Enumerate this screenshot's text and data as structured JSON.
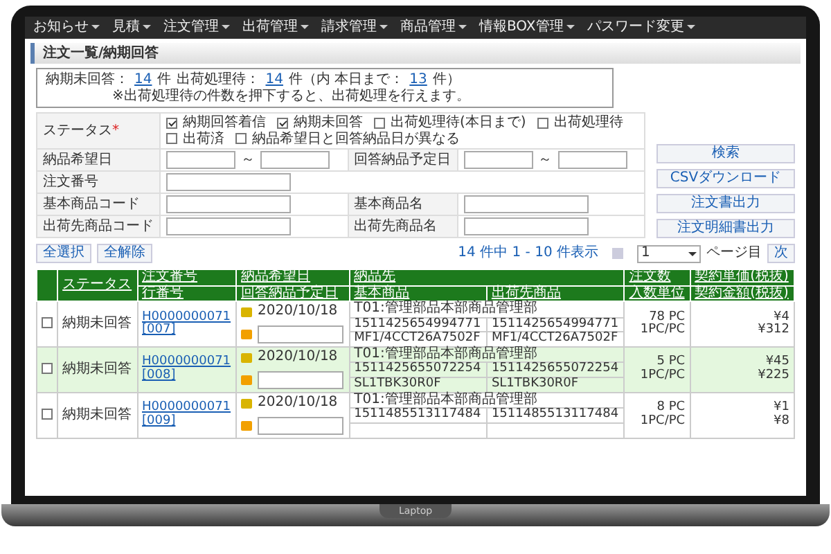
{
  "menu": [
    {
      "label": "お知らせ"
    },
    {
      "label": "見積"
    },
    {
      "label": "注文管理"
    },
    {
      "label": "出荷管理"
    },
    {
      "label": "請求管理"
    },
    {
      "label": "商品管理"
    },
    {
      "label": "情報BOX管理"
    },
    {
      "label": "パスワード変更"
    }
  ],
  "page_title": "注文一覧/納期回答",
  "summary": {
    "parts": [
      {
        "kind": "text",
        "text": "納期未回答："
      },
      {
        "kind": "link",
        "text": "14"
      },
      {
        "kind": "text",
        "text": "件"
      },
      {
        "kind": "text",
        "text": "出荷処理待："
      },
      {
        "kind": "link",
        "text": "14"
      },
      {
        "kind": "text",
        "text": "件（内 本日まで："
      },
      {
        "kind": "link",
        "text": "13"
      },
      {
        "kind": "text",
        "text": "件）"
      }
    ],
    "note": "※出荷処理待の件数を押下すると、出荷処理を行えます。"
  },
  "form": {
    "status_label": "ステータス",
    "required_mark": "*",
    "checkboxes": [
      {
        "label": "納期回答着信",
        "checked": true
      },
      {
        "label": "納期未回答",
        "checked": true
      },
      {
        "label": "出荷処理待(本日まで)",
        "checked": false
      },
      {
        "label": "出荷処理待",
        "checked": false
      },
      {
        "label": "出荷済",
        "checked": false
      },
      {
        "label": "納品希望日と回答納品日が異なる",
        "checked": false
      }
    ],
    "rows": [
      {
        "cells": [
          {
            "label": "納品希望日",
            "kind": "range",
            "separator": "～"
          },
          {
            "label": "回答納品予定日",
            "kind": "range",
            "separator": "～"
          }
        ]
      },
      {
        "cells": [
          {
            "label": "注文番号",
            "kind": "single"
          }
        ]
      },
      {
        "cells": [
          {
            "label": "基本商品コード",
            "kind": "single"
          },
          {
            "label": "基本商品名",
            "kind": "single"
          }
        ]
      },
      {
        "cells": [
          {
            "label": "出荷先商品コード",
            "kind": "single"
          },
          {
            "label": "出荷先商品名",
            "kind": "single"
          }
        ]
      }
    ]
  },
  "action_buttons": [
    {
      "label": "検索"
    },
    {
      "label": "CSVダウンロード"
    },
    {
      "label": "注文書出力"
    },
    {
      "label": "注文明細書出力"
    }
  ],
  "select_buttons": [
    {
      "label": "全選択"
    },
    {
      "label": "全解除"
    }
  ],
  "pagination": {
    "summary": "14 件中 1 - 10 件表示",
    "page": "1",
    "page_suffix": "ページ目",
    "next": "次"
  },
  "table": {
    "columns": [
      {
        "top": "ステータス"
      },
      {
        "top": "注文番号",
        "bottom": "行番号"
      },
      {
        "top": "納品希望日",
        "bottom": "回答納品予定日"
      },
      {
        "top": "納品先",
        "bottom": "基本商品",
        "bottom_2": "出荷先商品"
      },
      {
        "top": "注文数",
        "bottom": "入数単位"
      },
      {
        "top": "契約単価(税抜)",
        "bottom": "契約金額(税抜)"
      }
    ],
    "rows": [
      {
        "checked": false,
        "highlighted": false,
        "status": "納期未回答",
        "order_no": "H0000000071",
        "line_no": "[007]",
        "desired_date": "2020/10/18",
        "destination": "T01:管理部品本部商品管理部",
        "base_code": "1511425654994771",
        "base_name": "MF1/4CCT26A7502F",
        "ship_code": "1511425654994771",
        "ship_name": "MF1/4CCT26A7502F",
        "quantity": "78 PC",
        "unit": "1PC/PC",
        "unit_price": "¥4",
        "amount": "¥312"
      },
      {
        "checked": false,
        "highlighted": true,
        "status": "納期未回答",
        "order_no": "H0000000071",
        "line_no": "[008]",
        "desired_date": "2020/10/18",
        "destination": "T01:管理部品本部商品管理部",
        "base_code": "1511425655072254",
        "base_name": "SL1TBK30R0F",
        "ship_code": "1511425655072254",
        "ship_name": "SL1TBK30R0F",
        "quantity": "5 PC",
        "unit": "1PC/PC",
        "unit_price": "¥45",
        "amount": "¥225"
      },
      {
        "checked": false,
        "highlighted": false,
        "status": "納期未回答",
        "order_no": "H0000000071",
        "line_no": "[009]",
        "desired_date": "2020/10/18",
        "destination": "T01:管理部品本部商品管理部",
        "base_code": "1511485513117484",
        "base_name": "",
        "ship_code": "1511485513117484",
        "ship_name": "",
        "quantity": "8 PC",
        "unit": "1PC/PC",
        "unit_price": "¥1",
        "amount": "¥8"
      }
    ]
  },
  "laptop_label": "Laptop"
}
